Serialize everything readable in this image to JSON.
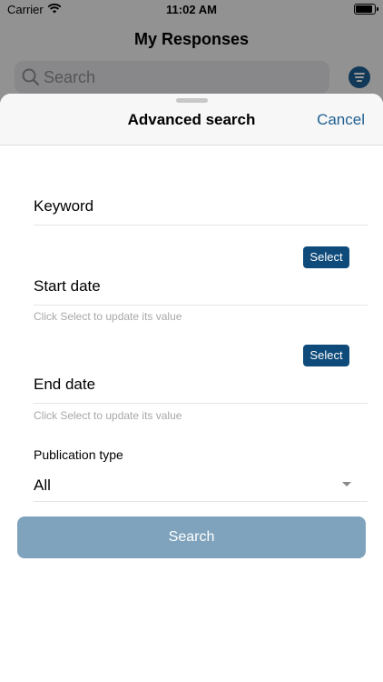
{
  "status_bar": {
    "carrier": "Carrier",
    "time": "11:02 AM",
    "battery_level": 0.85
  },
  "background": {
    "title": "My Responses",
    "search_placeholder": "Search"
  },
  "sheet": {
    "title": "Advanced search",
    "cancel_label": "Cancel",
    "keyword_label": "Keyword",
    "start_date_label": "Start date",
    "start_date_select_label": "Select",
    "start_date_helper": "Click Select to update its value",
    "end_date_label": "End date",
    "end_date_select_label": "Select",
    "end_date_helper": "Click Select to update its value",
    "publication_type_label": "Publication type",
    "publication_type_value": "All",
    "search_button_label": "Search"
  },
  "colors": {
    "accent": "#1f5f91",
    "select_button": "#0e4a7a",
    "search_button": "#7fa3bc"
  },
  "icons": [
    "wifi-icon",
    "battery-icon",
    "search-icon",
    "filter-icon",
    "chevron-down-icon"
  ]
}
